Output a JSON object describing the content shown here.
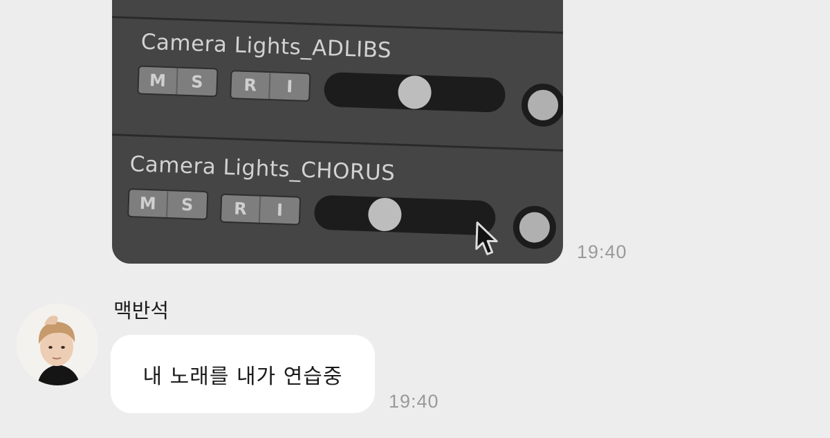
{
  "chat": {
    "messages": [
      {
        "type": "image",
        "time": "19:40",
        "image": {
          "tracks": [
            {
              "name": "Camera Lights_ADLIBS",
              "buttons": [
                "M",
                "S",
                "R",
                "I"
              ],
              "volume_fraction": 0.5
            },
            {
              "name": "Camera Lights_CHORUS",
              "buttons": [
                "M",
                "S",
                "R",
                "I"
              ],
              "volume_fraction": 0.42
            }
          ]
        }
      },
      {
        "type": "text",
        "sender": "맥반석",
        "text": "내 노래를 내가 연습중",
        "time": "19:40"
      }
    ]
  },
  "colors": {
    "background": "#ededed",
    "bubble": "#ffffff",
    "timestamp": "#9a9a9a"
  }
}
